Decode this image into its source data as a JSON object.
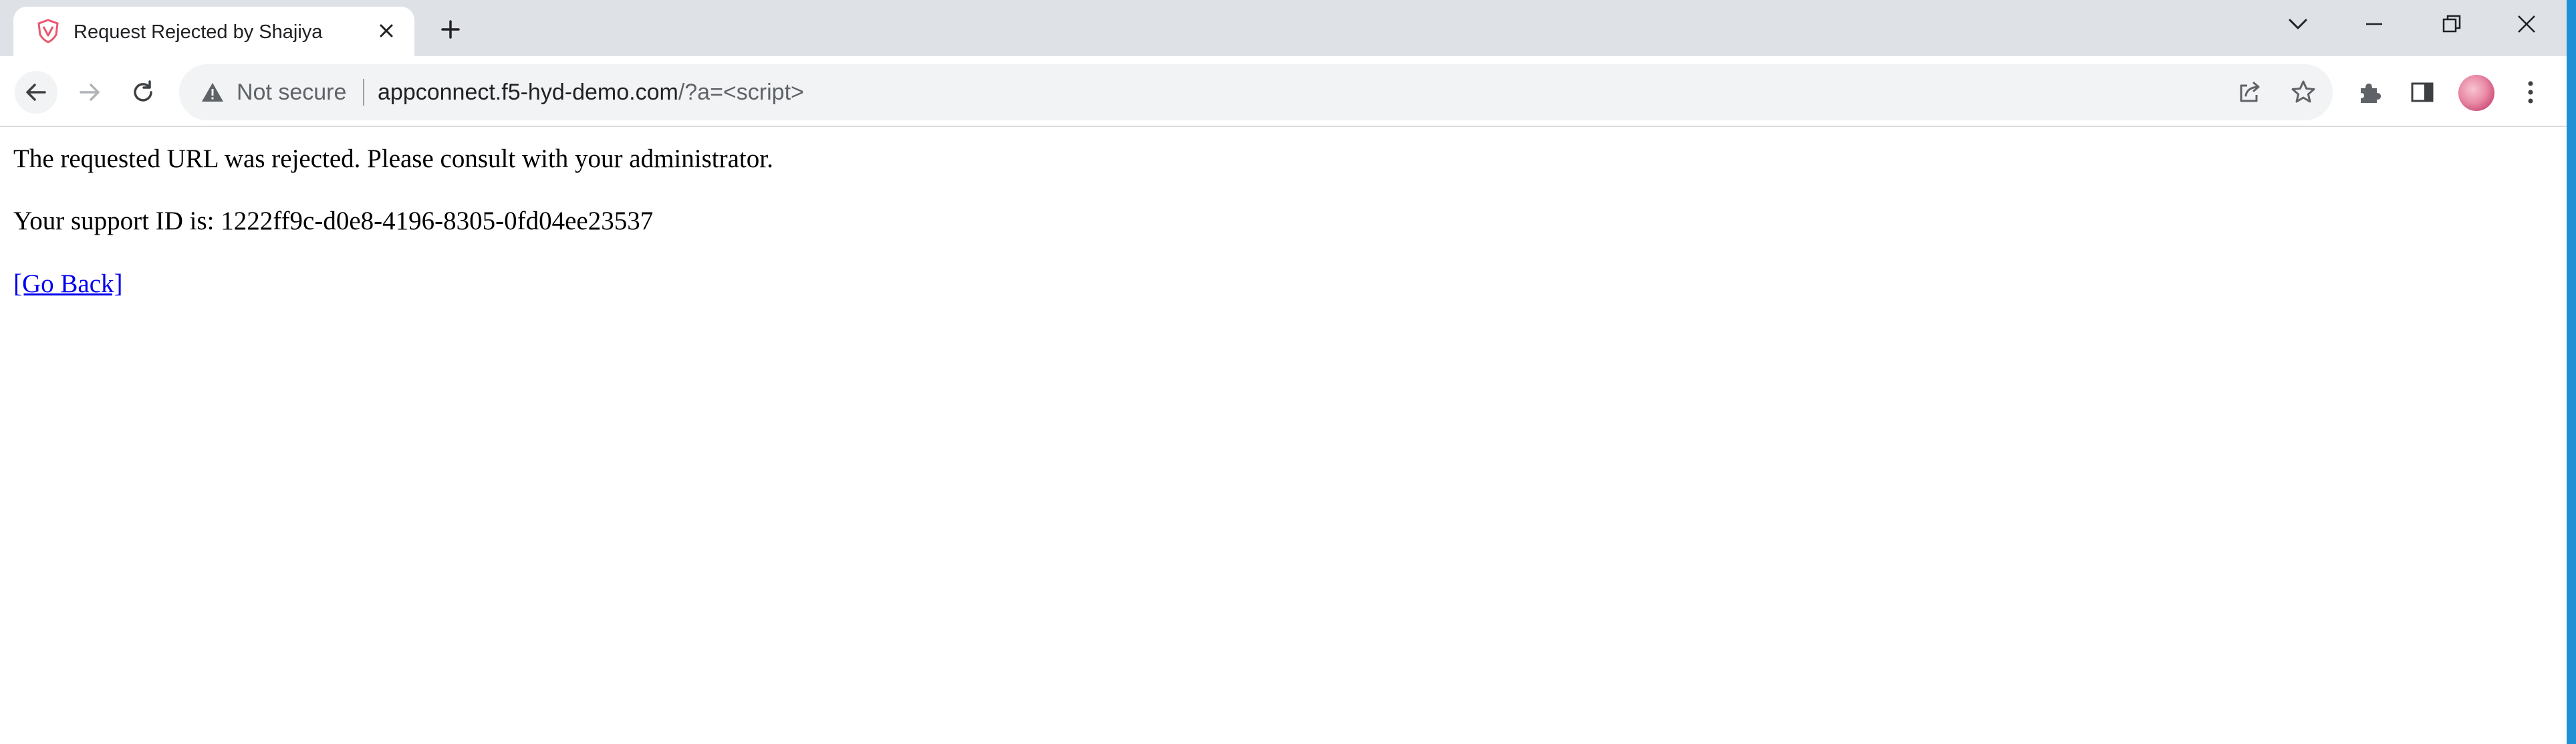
{
  "browser": {
    "tab": {
      "title": "Request Rejected by Shajiya",
      "favicon": "shield-icon"
    },
    "address_bar": {
      "security_label": "Not secure",
      "url_host": "appconnect.f5-hyd-demo.com",
      "url_path": "/?a=<script>"
    },
    "icons": {
      "back": "arrow-left-icon",
      "forward": "arrow-right-icon",
      "reload": "reload-icon",
      "share": "share-icon",
      "bookmark": "star-icon",
      "extensions": "puzzle-icon",
      "side_panel": "side-panel-icon",
      "menu": "kebab-menu-icon",
      "tab_search": "chevron-down-icon",
      "minimize": "minimize-icon",
      "restore": "restore-icon",
      "close": "close-icon"
    },
    "colors": {
      "tabstrip": "#dee1e6",
      "omnibox": "#f1f3f4",
      "link": "#0000ee",
      "taskbar_accent": "#1e90d6"
    }
  },
  "page": {
    "message": "The requested URL was rejected. Please consult with your administrator.",
    "support_id_line": "Your support ID is: 1222ff9c-d0e8-4196-8305-0fd04ee23537",
    "go_back_link": "[Go Back]"
  }
}
